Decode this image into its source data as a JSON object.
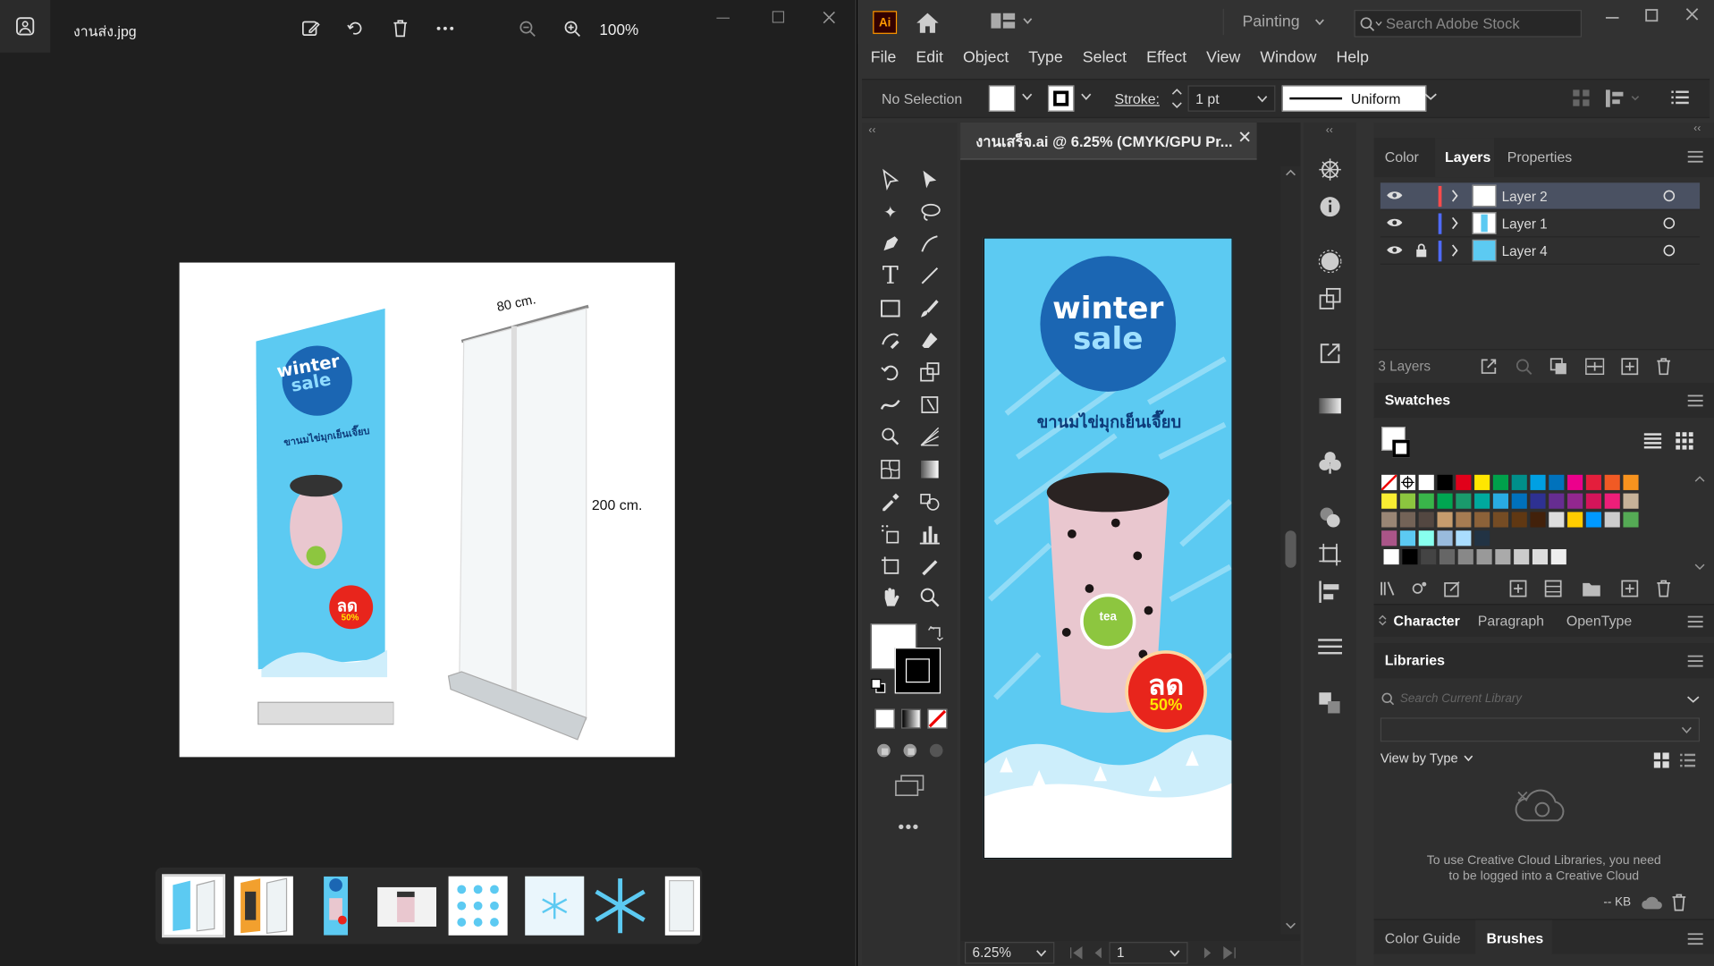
{
  "photos": {
    "file_name": "งานส่ง.jpg",
    "zoom": "100%",
    "photo": {
      "width_label": "80 cm.",
      "height_label": "200 cm."
    },
    "thumbnails": [
      "banner-stand",
      "side-banner",
      "drink-banner",
      "drink-photo",
      "snowflakes-sheet",
      "snowflake-small",
      "snowflake-large",
      "stand-side"
    ]
  },
  "banner": {
    "headline1": "winter",
    "headline2": "sale",
    "thai": "ขานมไข่มุกเย็นเจี๊ยบ",
    "logo": "tea",
    "badge_main": "ลด",
    "badge_sub": "50%",
    "colors": {
      "sky": "#5ccaf2",
      "navy": "#1b66b3",
      "red": "#e8251c",
      "yellow": "#ffe600",
      "lime": "#8dc63f"
    }
  },
  "illustrator": {
    "logo": "Ai",
    "workspace": "Painting",
    "search_placeholder": "Search Adobe Stock",
    "menu": [
      "File",
      "Edit",
      "Object",
      "Type",
      "Select",
      "Effect",
      "View",
      "Window",
      "Help"
    ],
    "control": {
      "selection": "No Selection",
      "stroke_label": "Stroke:",
      "stroke_value": "1 pt",
      "profile": "Uniform"
    },
    "document_tab": "งานเสร็จ.ai @ 6.25% (CMYK/GPU Pr...",
    "zoom_value": "6.25%",
    "artboard_value": "1",
    "panels": {
      "tabs1": [
        "Color",
        "Layers",
        "Properties"
      ],
      "layers": [
        {
          "name": "Layer 2",
          "color": "#ff4b4b"
        },
        {
          "name": "Layer 1",
          "color": "#4f6bff"
        },
        {
          "name": "Layer 4",
          "color": "#4f6bff"
        }
      ],
      "layers_count": "3 Layers",
      "swatches_title": "Swatches",
      "tabs2": [
        "Character",
        "Paragraph",
        "OpenType"
      ],
      "libraries_title": "Libraries",
      "libraries_search_placeholder": "Search Current Library",
      "view_by_type": "View by Type",
      "libraries_msg1": "To use Creative Cloud Libraries, you need",
      "libraries_msg2": "to be logged into a Creative Cloud",
      "kb": "-- KB",
      "tabs3": [
        "Color Guide",
        "Brushes"
      ]
    }
  }
}
